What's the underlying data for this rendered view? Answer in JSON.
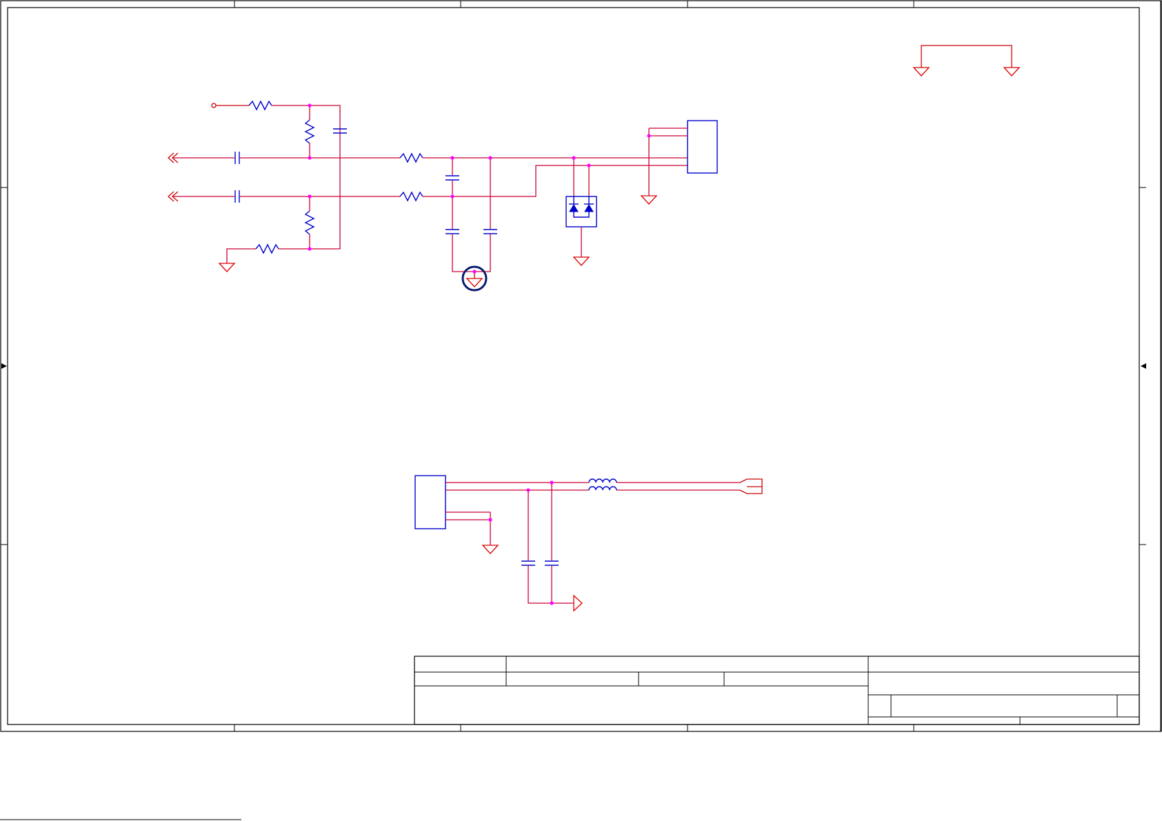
{
  "sheet": {
    "colors": {
      "wire": "#cc0000",
      "component": "#0000cc",
      "junction": "#ff00ff",
      "ground": "#dd0000",
      "frame": "#000000"
    },
    "icons": [
      "ground-symbol",
      "resistor-symbol",
      "capacitor-symbol",
      "inductor-symbol",
      "tvs-diode-array-symbol",
      "connector-symbol",
      "off-page-connector-symbol",
      "chassis-ground-symbol"
    ]
  }
}
